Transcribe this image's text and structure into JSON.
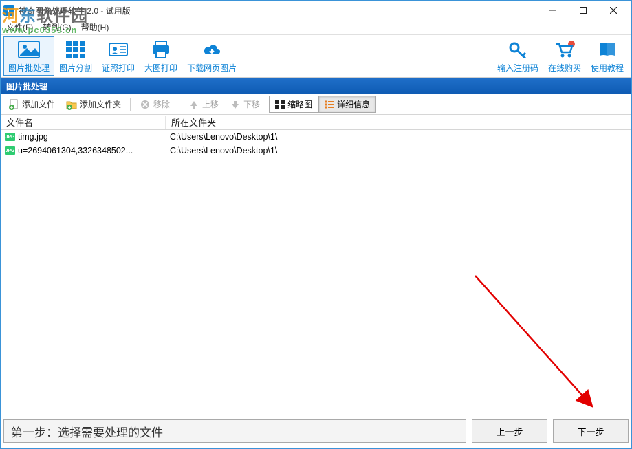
{
  "window": {
    "title": "神奇图像处理软件 2.0 - 试用版"
  },
  "menubar": {
    "file": "文件(F)",
    "goto": "转到(G)",
    "help": "帮助(H)"
  },
  "watermark": {
    "text": "河东软件园",
    "url": "www.pc0359.cn"
  },
  "ribbon": {
    "batch": "图片批处理",
    "split": "图片分割",
    "idprint": "证照打印",
    "bigprint": "大图打印",
    "download": "下载网页图片",
    "regcode": "输入注册码",
    "buy": "在线购买",
    "tutorial": "使用教程"
  },
  "panel": {
    "title": "图片批处理"
  },
  "toolbar": {
    "add_file": "添加文件",
    "add_folder": "添加文件夹",
    "remove": "移除",
    "move_up": "上移",
    "move_down": "下移",
    "thumb": "缩略图",
    "detail": "详细信息"
  },
  "columns": {
    "filename": "文件名",
    "folder": "所在文件夹"
  },
  "files": [
    {
      "name": "timg.jpg",
      "folder": "C:\\Users\\Lenovo\\Desktop\\1\\"
    },
    {
      "name": "u=2694061304,3326348502...",
      "folder": "C:\\Users\\Lenovo\\Desktop\\1\\"
    }
  ],
  "footer": {
    "step_text": "第一步：选择需要处理的文件",
    "prev": "上一步",
    "next": "下一步"
  }
}
